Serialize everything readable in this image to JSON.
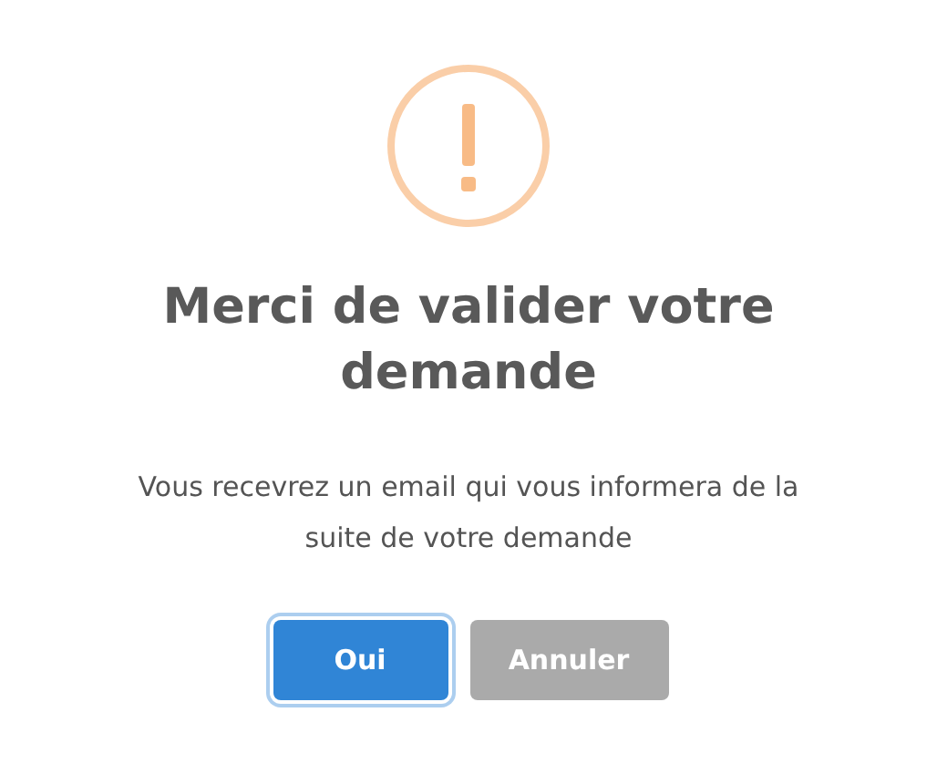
{
  "dialog": {
    "icon": {
      "kind": "warning"
    },
    "title": "Merci de valider votre demande",
    "message": "Vous recevrez un email qui vous informera de la suite de votre demande",
    "buttons": [
      {
        "label": "Oui",
        "kind": "confirm",
        "focused": true
      },
      {
        "label": "Annuler",
        "kind": "cancel",
        "focused": false
      }
    ]
  }
}
